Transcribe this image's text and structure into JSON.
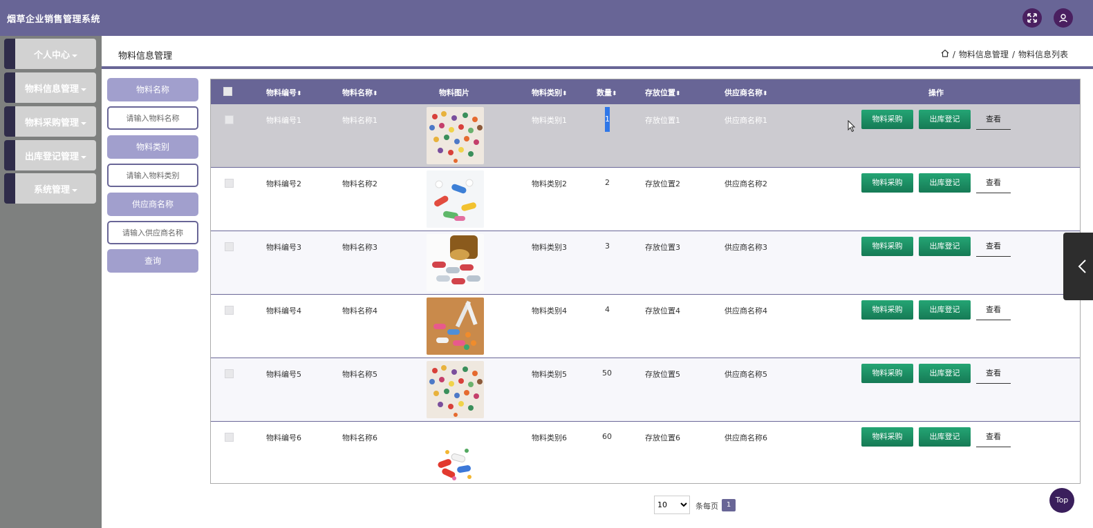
{
  "header": {
    "app_title": "烟草企业销售管理系统",
    "icons": [
      "fullscreen-icon",
      "user-icon"
    ]
  },
  "sidebar": {
    "items": [
      {
        "label": "个人中心"
      },
      {
        "label": "物料信息管理"
      },
      {
        "label": "物料采购管理"
      },
      {
        "label": "出库登记管理"
      },
      {
        "label": "系统管理"
      }
    ]
  },
  "breadcrumb": {
    "title": "物料信息管理",
    "path": [
      "物料信息管理",
      "物料信息列表"
    ],
    "separator": "/"
  },
  "search": {
    "name_label": "物料名称",
    "name_placeholder": "请输入物料名称",
    "category_label": "物料类别",
    "category_placeholder": "请输入物料类别",
    "supplier_label": "供应商名称",
    "supplier_placeholder": "请输入供应商名称",
    "query_label": "查询"
  },
  "table": {
    "columns": [
      "物料编号",
      "物料名称",
      "物料图片",
      "物料类别",
      "数量",
      "存放位置",
      "供应商名称",
      "操作"
    ],
    "rows": [
      {
        "code": "物料编号1",
        "name": "物料名称1",
        "category": "物料类别1",
        "qty": "1",
        "location": "存放位置1",
        "supplier": "供应商名称1"
      },
      {
        "code": "物料编号2",
        "name": "物料名称2",
        "category": "物料类别2",
        "qty": "2",
        "location": "存放位置2",
        "supplier": "供应商名称2"
      },
      {
        "code": "物料编号3",
        "name": "物料名称3",
        "category": "物料类别3",
        "qty": "3",
        "location": "存放位置3",
        "supplier": "供应商名称3"
      },
      {
        "code": "物料编号4",
        "name": "物料名称4",
        "category": "物料类别4",
        "qty": "4",
        "location": "存放位置4",
        "supplier": "供应商名称4"
      },
      {
        "code": "物料编号5",
        "name": "物料名称5",
        "category": "物料类别5",
        "qty": "50",
        "location": "存放位置5",
        "supplier": "供应商名称5"
      },
      {
        "code": "物料编号6",
        "name": "物料名称6",
        "category": "物料类别6",
        "qty": "60",
        "location": "存放位置6",
        "supplier": "供应商名称6"
      }
    ],
    "actions": {
      "buy": "物料采购",
      "out": "出库登记",
      "view": "查看"
    }
  },
  "pagination": {
    "page_size": "10",
    "per_page_label": "条每页",
    "current_page": "1"
  },
  "floating": {
    "top_label": "Top"
  },
  "colors": {
    "primary": "#686596",
    "label_bg": "#a19fcd",
    "action_green": "#1f9a6b",
    "sidebar_bg": "#7e807f",
    "selected_row": "#cccbd0",
    "alt_row": "#f7f7fb"
  }
}
